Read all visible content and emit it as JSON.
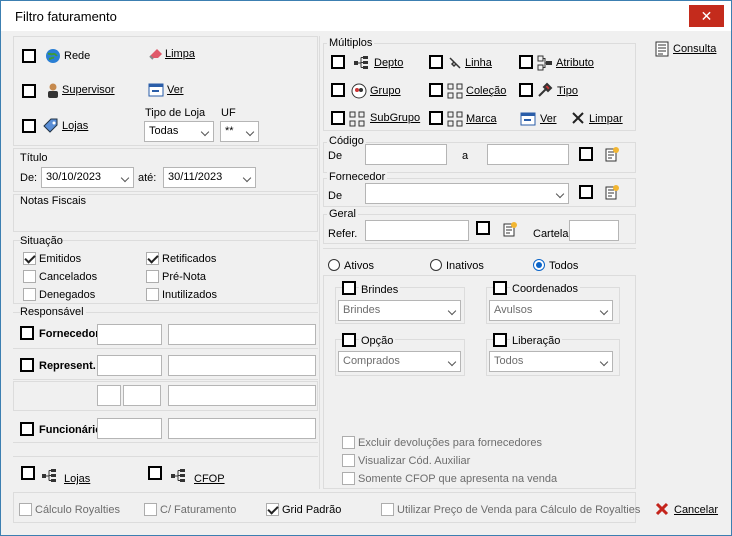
{
  "window": {
    "title": "Filtro faturamento",
    "close": "✕"
  },
  "top": {
    "rede": "Rede",
    "supervisor": "Supervisor",
    "lojas": "Lojas",
    "limpa": "Limpa",
    "ver": "Ver",
    "tipo_loja_label": "Tipo de Loja",
    "tipo_loja_value": "Todas",
    "uf_label": "UF",
    "uf_value": "**"
  },
  "titulo": {
    "label": "Título",
    "de_label": "De:",
    "de_value": "30/10/2023",
    "ate_label": "até:",
    "ate_value": "30/11/2023"
  },
  "notas": {
    "label": "Notas Fiscais"
  },
  "situacao": {
    "label": "Situação",
    "emitidos": "Emitidos",
    "cancelados": "Cancelados",
    "denegados": "Denegados",
    "retificados": "Retificados",
    "prenota": "Pré-Nota",
    "inutilizados": "Inutilizados"
  },
  "responsavel": {
    "label": "Responsável",
    "fornecedor": "Fornecedor",
    "represent": "Represent.",
    "funcionario": "Funcionário"
  },
  "bottom_left": {
    "lojas": "Lojas",
    "cfop": "CFOP"
  },
  "multiplos": {
    "label": "Múltiplos",
    "depto": "Depto",
    "linha": "Linha",
    "atributo": "Atributo",
    "grupo": "Grupo",
    "colecao": "Coleção",
    "tipo": "Tipo",
    "subgrupo": "SubGrupo",
    "marca": "Marca",
    "ver": "Ver",
    "limpar": "Limpar"
  },
  "codigo": {
    "label": "Código",
    "de": "De",
    "a": "a"
  },
  "fornecedor": {
    "label": "Fornecedor",
    "de": "De"
  },
  "geral": {
    "label": "Geral",
    "refer": "Refer.",
    "cartela": "Cartela"
  },
  "status": {
    "ativos": "Ativos",
    "inativos": "Inativos",
    "todos": "Todos"
  },
  "brindes": {
    "label": "Brindes",
    "value": "Brindes"
  },
  "coordenados": {
    "label": "Coordenados",
    "value": "Avulsos"
  },
  "opcao": {
    "label": "Opção",
    "value": "Comprados"
  },
  "liberacao": {
    "label": "Liberação",
    "value": "Todos"
  },
  "extras": {
    "excluir": "Excluir devoluções para fornecedores",
    "visualizar": "Visualizar Cód. Auxiliar",
    "somente": "Somente CFOP que apresenta na venda"
  },
  "footer": {
    "royalties": "Cálculo Royalties",
    "faturamento": "C/ Faturamento",
    "grid": "Grid Padrão",
    "utilizar": "Utilizar Preço de Venda para Cálculo de Royalties"
  },
  "actions": {
    "consulta": "Consulta",
    "cancelar": "Cancelar"
  }
}
